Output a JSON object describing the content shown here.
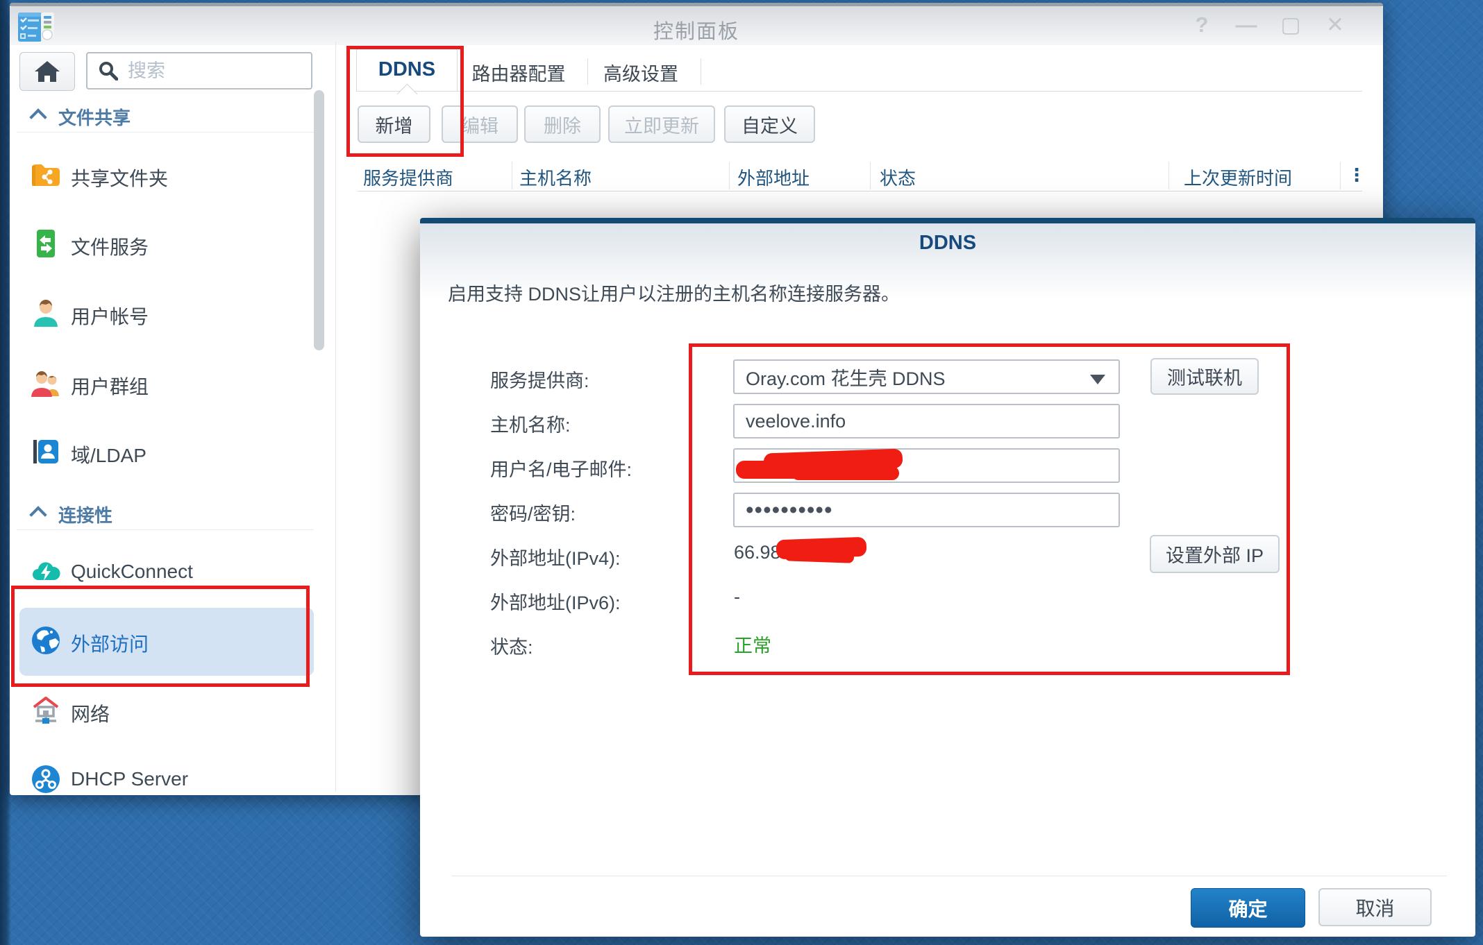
{
  "window": {
    "title": "控制面板",
    "controls": [
      {
        "name": "help",
        "glyph": "?"
      },
      {
        "name": "minimize",
        "glyph": "—"
      },
      {
        "name": "maximize",
        "glyph": "▢"
      },
      {
        "name": "close",
        "glyph": "✕"
      }
    ]
  },
  "sidebar": {
    "search_placeholder": "搜索",
    "sections": [
      {
        "label": "文件共享",
        "items": [
          {
            "label": "共享文件夹",
            "icon": "shared-folder"
          },
          {
            "label": "文件服务",
            "icon": "file-services"
          },
          {
            "label": "用户帐号",
            "icon": "user-account"
          },
          {
            "label": "用户群组",
            "icon": "user-group"
          },
          {
            "label": "域/LDAP",
            "icon": "domain-ldap"
          }
        ]
      },
      {
        "label": "连接性",
        "items": [
          {
            "label": "QuickConnect",
            "icon": "quickconnect"
          },
          {
            "label": "外部访问",
            "icon": "external-access",
            "selected": true
          },
          {
            "label": "网络",
            "icon": "network"
          },
          {
            "label": "DHCP Server",
            "icon": "dhcp-server"
          }
        ]
      }
    ]
  },
  "tabs": [
    {
      "label": "DDNS",
      "active": true
    },
    {
      "label": "路由器配置",
      "active": false
    },
    {
      "label": "高级设置",
      "active": false
    }
  ],
  "toolbar": [
    {
      "label": "新增",
      "enabled": true
    },
    {
      "label": "编辑",
      "enabled": false
    },
    {
      "label": "删除",
      "enabled": false
    },
    {
      "label": "立即更新",
      "enabled": false
    },
    {
      "label": "自定义",
      "enabled": true
    }
  ],
  "table": {
    "columns": [
      "服务提供商",
      "主机名称",
      "外部地址",
      "状态",
      "上次更新时间"
    ],
    "menu_icon": "⋮",
    "rows": []
  },
  "dialog": {
    "title": "DDNS",
    "description": "启用支持 DDNS让用户以注册的主机名称连接服务器。",
    "fields": {
      "provider": {
        "label": "服务提供商:",
        "value": "Oray.com 花生壳 DDNS"
      },
      "hostname": {
        "label": "主机名称:",
        "value": "veelove.info"
      },
      "username": {
        "label": "用户名/电子邮件:",
        "value": "",
        "redacted": true
      },
      "password": {
        "label": "密码/密钥:",
        "value": "••••••••••"
      },
      "ipv4": {
        "label": "外部地址(IPv4):",
        "value": "66.98",
        "redacted": true
      },
      "ipv6": {
        "label": "外部地址(IPv6):",
        "value": "-"
      },
      "status": {
        "label": "状态:",
        "value": "正常",
        "color": "#28a428"
      }
    },
    "buttons": {
      "test": "测试联机",
      "set_ip": "设置外部 IP",
      "ok": "确定",
      "cancel": "取消"
    }
  },
  "annotations": {
    "color": "#e81c1c"
  }
}
